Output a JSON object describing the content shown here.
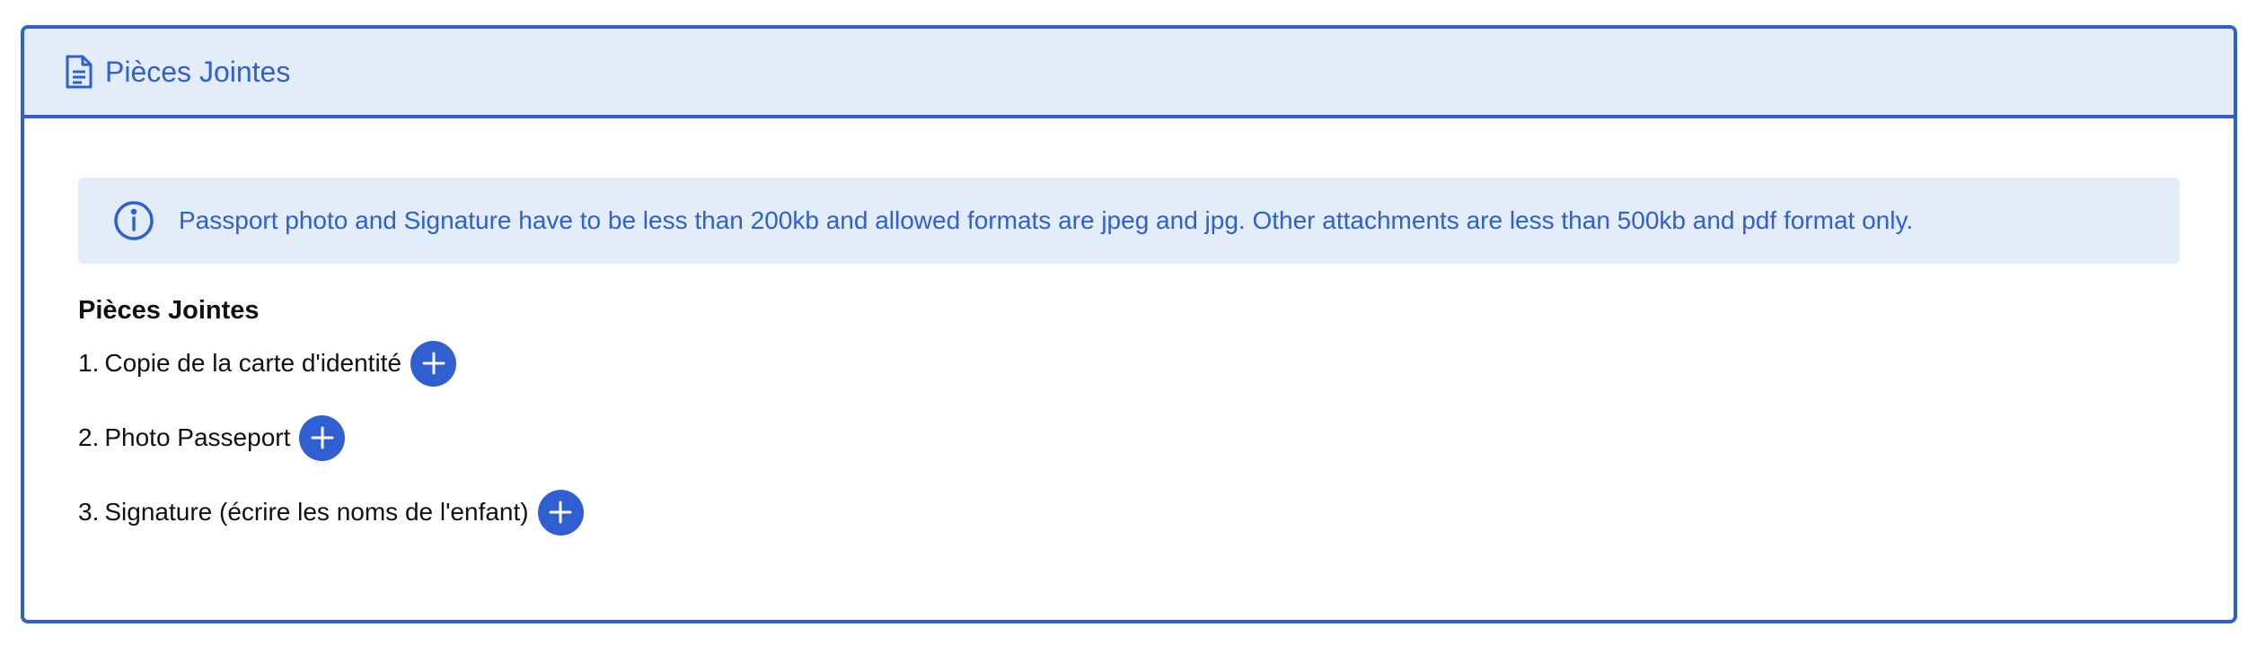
{
  "card": {
    "title": "Pièces Jointes",
    "header_icon": "document-icon"
  },
  "info": {
    "icon": "info-icon",
    "text": "Passport photo and Signature have to be less than 200kb and allowed formats are jpeg and jpg. Other attachments are less than 500kb and pdf format only."
  },
  "attachments": {
    "title": "Pièces Jointes",
    "items": [
      {
        "number": "1.",
        "label": "Copie de la carte d'identité",
        "action_icon": "plus-icon"
      },
      {
        "number": "2.",
        "label": "Photo Passeport",
        "action_icon": "plus-icon"
      },
      {
        "number": "3.",
        "label": "Signature (écrire les noms de l'enfant)",
        "action_icon": "plus-icon"
      }
    ]
  },
  "colors": {
    "accent": "#2f5fd0",
    "header_bg": "#e2edf9",
    "info_bg": "#e2edf9"
  }
}
